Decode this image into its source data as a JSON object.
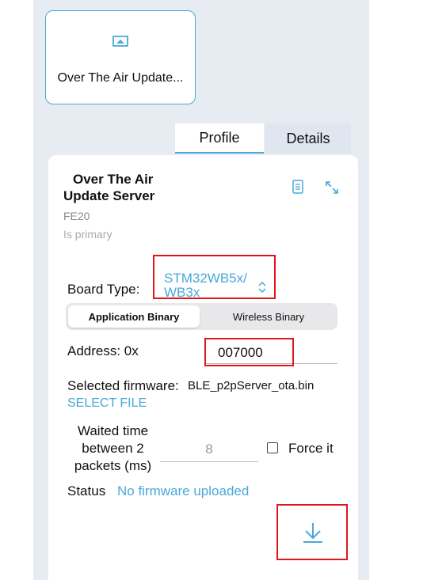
{
  "service_card": {
    "label": "Over The Air Update...",
    "icon": "upload-box-icon"
  },
  "tabs": [
    {
      "label": "Profile",
      "active": true
    },
    {
      "label": "Details",
      "active": false
    }
  ],
  "service": {
    "title_line1": "Over The Air",
    "title_line2": "Update Server",
    "uuid": "FE20",
    "primary": "Is primary",
    "doc_icon": "document-icon",
    "expand_icon": "expand-icon"
  },
  "board": {
    "label": "Board Type:",
    "value_line1": "STM32WB5x/",
    "value_line2": "WB3x"
  },
  "segment": {
    "options": [
      "Application Binary",
      "Wireless Binary"
    ],
    "selected": "Application Binary"
  },
  "address": {
    "label": "Address: 0x",
    "value": "007000"
  },
  "firmware": {
    "label": "Selected firmware:",
    "name": "BLE_p2pServer_ota.bin",
    "select_label": "SELECT FILE"
  },
  "wait": {
    "label_line1": "Waited time",
    "label_line2": "between 2",
    "label_line3": "packets (ms)",
    "value": "8"
  },
  "force": {
    "label": "Force it",
    "checked": false
  },
  "status": {
    "label": "Status",
    "value": "No firmware uploaded"
  },
  "colors": {
    "accent": "#4aa8d8",
    "highlight_box": "#e0161b",
    "panel_bg": "#e7ecf3"
  }
}
